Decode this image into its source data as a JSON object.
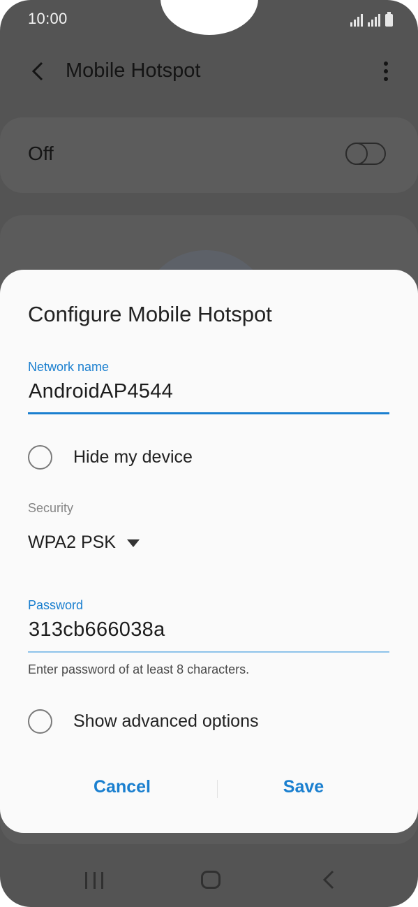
{
  "status_bar": {
    "time": "10:00"
  },
  "app_bar": {
    "title": "Mobile Hotspot"
  },
  "hotspot_switch": {
    "label": "Off",
    "state": "off"
  },
  "dialog": {
    "title": "Configure Mobile Hotspot",
    "network_name": {
      "label": "Network name",
      "value": "AndroidAP4544"
    },
    "hide_device": {
      "label": "Hide my device",
      "checked": false
    },
    "security": {
      "label": "Security",
      "value": "WPA2 PSK"
    },
    "password": {
      "label": "Password",
      "value": "313cb666038a",
      "helper": "Enter password of at least 8 characters."
    },
    "advanced": {
      "label": "Show advanced options",
      "checked": false
    },
    "buttons": {
      "cancel": "Cancel",
      "save": "Save"
    }
  },
  "colors": {
    "accent": "#1a7fcf",
    "scrim": "#545454",
    "dialog_bg": "#fafafa"
  }
}
